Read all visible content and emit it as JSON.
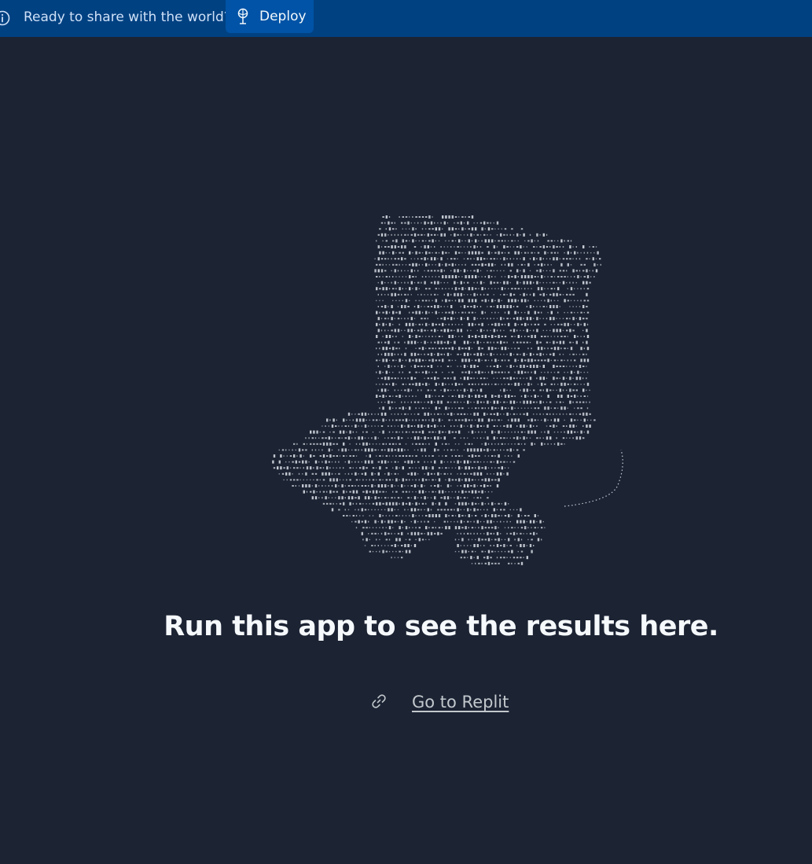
{
  "banner": {
    "message": "Ready to share with the world?",
    "deploy_label": "Deploy",
    "info_icon": "info-icon",
    "deploy_icon": "deploy-icon"
  },
  "main": {
    "illustration": "ascii-art-hand-holding-box",
    "headline": "Run this app to see the results here.",
    "link_label": "Go to Replit",
    "link_icon": "link-icon"
  },
  "colors": {
    "background": "#1c2333",
    "banner": "#004182",
    "deploy_button": "#0053a6",
    "text": "#f5f9fc",
    "muted_text": "#c2c8cc"
  }
}
